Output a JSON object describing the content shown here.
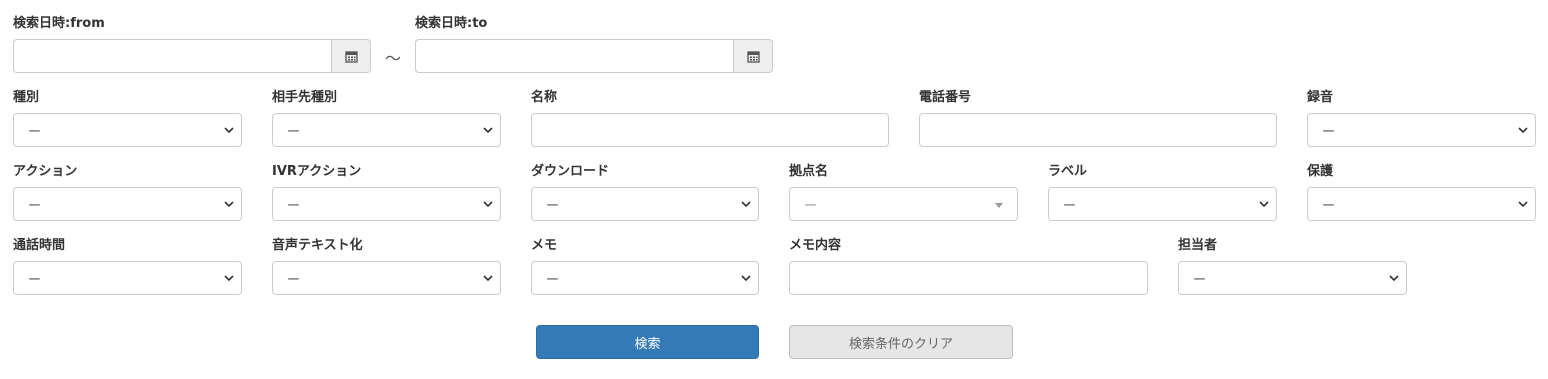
{
  "date_range": {
    "from_label": "検索日時:from",
    "to_label": "検索日時:to",
    "from_value": "",
    "to_value": "",
    "separator": "～",
    "calendar_icon": "calendar-icon"
  },
  "row1": {
    "kind": {
      "label": "種別",
      "value": "ー"
    },
    "partner_kind": {
      "label": "相手先種別",
      "value": "ー"
    },
    "name": {
      "label": "名称",
      "value": ""
    },
    "phone": {
      "label": "電話番号",
      "value": ""
    },
    "recording": {
      "label": "録音",
      "value": "ー"
    }
  },
  "row2": {
    "action": {
      "label": "アクション",
      "value": "ー"
    },
    "ivr_action": {
      "label": "IVRアクション",
      "value": "ー"
    },
    "download": {
      "label": "ダウンロード",
      "value": "ー"
    },
    "site_name": {
      "label": "拠点名",
      "value": "ー"
    },
    "label": {
      "label": "ラベル",
      "value": "ー"
    },
    "protect": {
      "label": "保護",
      "value": "ー"
    }
  },
  "row3": {
    "duration": {
      "label": "通話時間",
      "value": "ー"
    },
    "transcription": {
      "label": "音声テキスト化",
      "value": "ー"
    },
    "memo": {
      "label": "メモ",
      "value": "ー"
    },
    "memo_content": {
      "label": "メモ内容",
      "value": ""
    },
    "assignee": {
      "label": "担当者",
      "value": "ー"
    }
  },
  "buttons": {
    "search": "検索",
    "clear": "検索条件のクリア"
  },
  "colors": {
    "primary": "#337ab7",
    "secondary_bg": "#e6e6e6",
    "border": "#cccccc"
  }
}
